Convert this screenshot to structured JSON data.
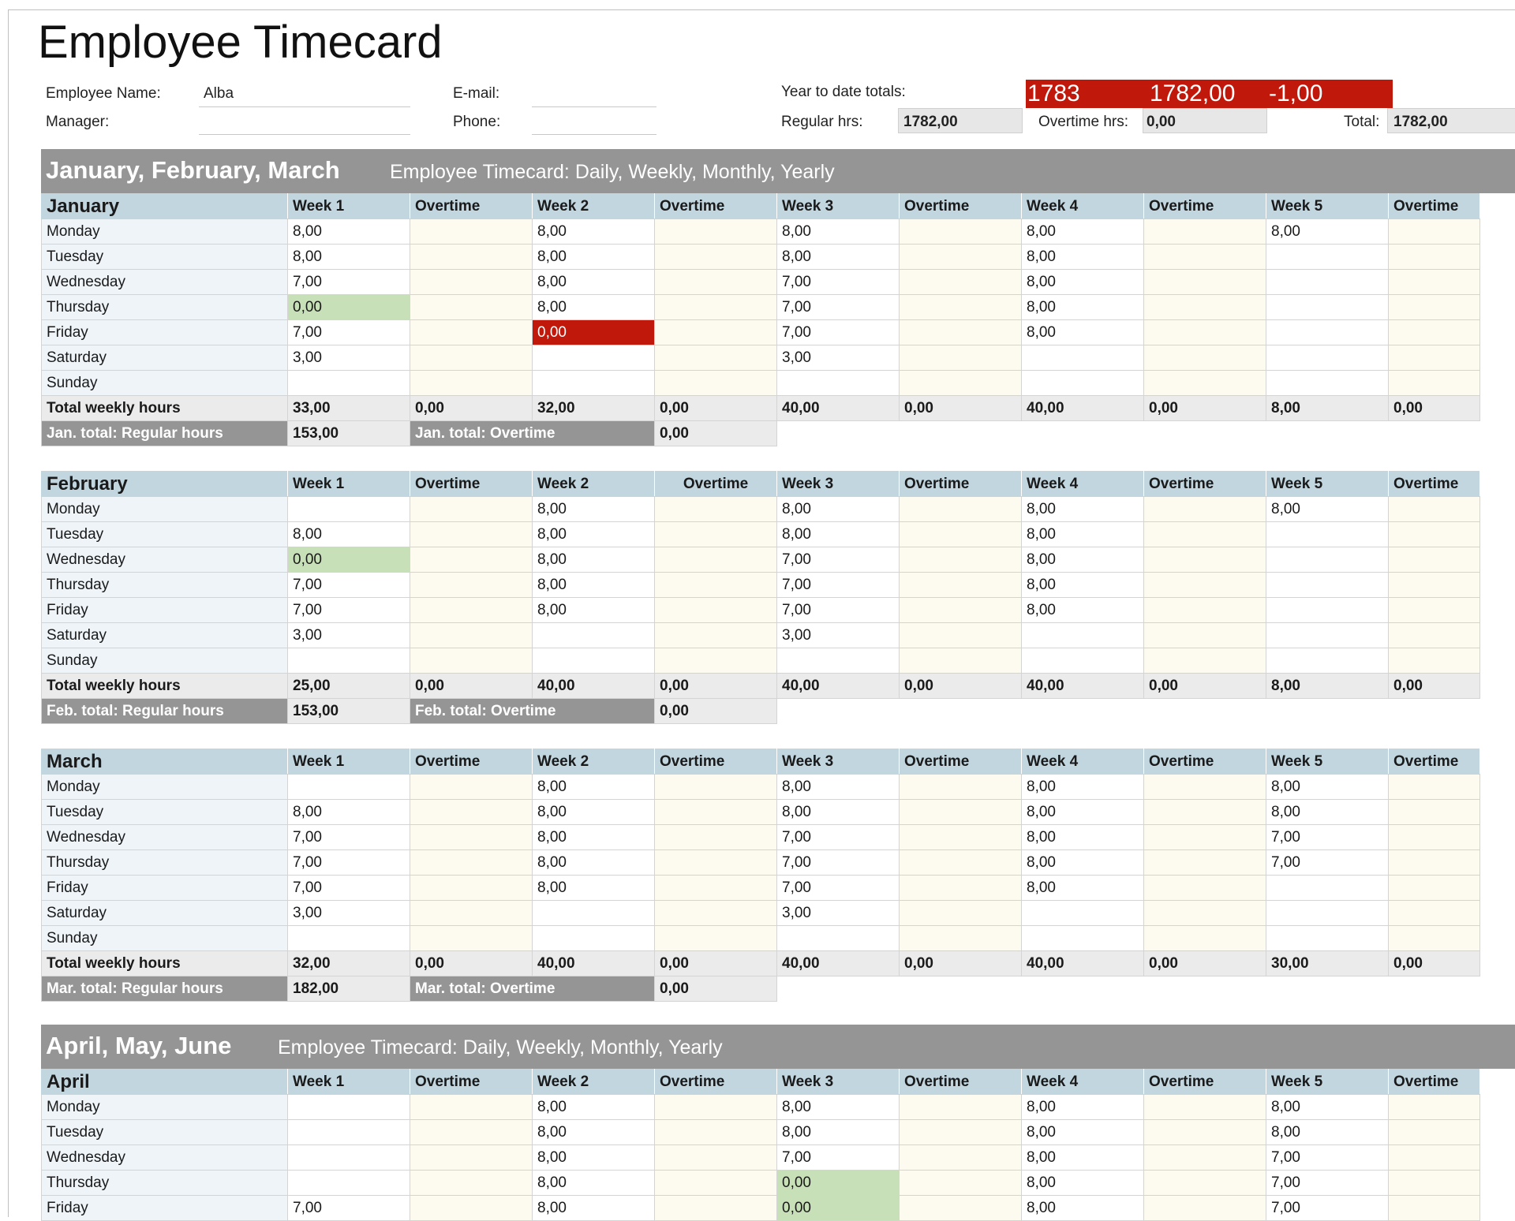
{
  "title": "Employee Timecard",
  "info": {
    "employee_name_label": "Employee Name:",
    "employee_name": "Alba",
    "manager_label": "Manager:",
    "manager": "",
    "email_label": "E-mail:",
    "email": "",
    "phone_label": "Phone:",
    "phone": ""
  },
  "ytd": {
    "label": "Year to date totals:",
    "v1": "1783",
    "v2": "1782,00",
    "v3": "-1,00",
    "regular_label": "Regular hrs:",
    "regular": "1782,00",
    "overtime_label": "Overtime hrs:",
    "overtime": "0,00",
    "total_label": "Total:",
    "total": "1782,00"
  },
  "colors": {
    "accent_red": "#c0180b",
    "header_blue": "#c2d6e0",
    "header_grey": "#959595",
    "green_highlight": "#c8e0b8"
  },
  "quarters": [
    {
      "title": "January, February, March",
      "subtitle": "Employee Timecard: Daily, Weekly, Monthly, Yearly"
    },
    {
      "title": "April, May, June",
      "subtitle": "Employee Timecard: Daily, Weekly, Monthly, Yearly"
    }
  ],
  "cols": [
    "Week 1",
    "Overtime",
    "Week 2",
    "Overtime",
    "Week 3",
    "Overtime",
    "Week 4",
    "Overtime",
    "Week 5",
    "Overtime"
  ],
  "months": [
    {
      "name": "January",
      "days": [
        "Monday",
        "Tuesday",
        "Wednesday",
        "Thursday",
        "Friday",
        "Saturday",
        "Sunday"
      ],
      "rows": [
        [
          "8,00",
          "",
          "8,00",
          "",
          "8,00",
          "",
          "8,00",
          "",
          "8,00",
          ""
        ],
        [
          "8,00",
          "",
          "8,00",
          "",
          "8,00",
          "",
          "8,00",
          "",
          "",
          ""
        ],
        [
          "7,00",
          "",
          "8,00",
          "",
          "7,00",
          "",
          "8,00",
          "",
          "",
          ""
        ],
        [
          "0,00",
          "",
          "8,00",
          "",
          "7,00",
          "",
          "8,00",
          "",
          "",
          ""
        ],
        [
          "7,00",
          "",
          "0,00",
          "",
          "7,00",
          "",
          "8,00",
          "",
          "",
          ""
        ],
        [
          "3,00",
          "",
          "",
          "",
          "3,00",
          "",
          "",
          "",
          "",
          ""
        ],
        [
          "",
          "",
          "",
          "",
          "",
          "",
          "",
          "",
          "",
          ""
        ]
      ],
      "total_label": "Total weekly hours",
      "totals": [
        "33,00",
        "0,00",
        "32,00",
        "0,00",
        "40,00",
        "0,00",
        "40,00",
        "0,00",
        "8,00",
        "0,00"
      ],
      "reg_label": "Jan. total: Regular hours",
      "reg_value": "153,00",
      "ot_label": "Jan. total: Overtime",
      "ot_value": "0,00"
    },
    {
      "name": "February",
      "days": [
        "Monday",
        "Tuesday",
        "Wednesday",
        "Thursday",
        "Friday",
        "Saturday",
        "Sunday"
      ],
      "rows": [
        [
          "",
          "",
          "8,00",
          "",
          "8,00",
          "",
          "8,00",
          "",
          "8,00",
          ""
        ],
        [
          "8,00",
          "",
          "8,00",
          "",
          "8,00",
          "",
          "8,00",
          "",
          "",
          ""
        ],
        [
          "0,00",
          "",
          "8,00",
          "",
          "7,00",
          "",
          "8,00",
          "",
          "",
          ""
        ],
        [
          "7,00",
          "",
          "8,00",
          "",
          "7,00",
          "",
          "8,00",
          "",
          "",
          ""
        ],
        [
          "7,00",
          "",
          "8,00",
          "",
          "7,00",
          "",
          "8,00",
          "",
          "",
          ""
        ],
        [
          "3,00",
          "",
          "",
          "",
          "3,00",
          "",
          "",
          "",
          "",
          ""
        ],
        [
          "",
          "",
          "",
          "",
          "",
          "",
          "",
          "",
          "",
          ""
        ]
      ],
      "total_label": "Total weekly hours",
      "totals": [
        "25,00",
        "0,00",
        "40,00",
        "0,00",
        "40,00",
        "0,00",
        "40,00",
        "0,00",
        "8,00",
        "0,00"
      ],
      "reg_label": "Feb. total: Regular hours",
      "reg_value": "153,00",
      "ot_label": "Feb.  total: Overtime",
      "ot_value": "0,00"
    },
    {
      "name": "March",
      "days": [
        "Monday",
        "Tuesday",
        "Wednesday",
        "Thursday",
        "Friday",
        "Saturday",
        "Sunday"
      ],
      "rows": [
        [
          "",
          "",
          "8,00",
          "",
          "8,00",
          "",
          "8,00",
          "",
          "8,00",
          ""
        ],
        [
          "8,00",
          "",
          "8,00",
          "",
          "8,00",
          "",
          "8,00",
          "",
          "8,00",
          ""
        ],
        [
          "7,00",
          "",
          "8,00",
          "",
          "7,00",
          "",
          "8,00",
          "",
          "7,00",
          ""
        ],
        [
          "7,00",
          "",
          "8,00",
          "",
          "7,00",
          "",
          "8,00",
          "",
          "7,00",
          ""
        ],
        [
          "7,00",
          "",
          "8,00",
          "",
          "7,00",
          "",
          "8,00",
          "",
          "",
          ""
        ],
        [
          "3,00",
          "",
          "",
          "",
          "3,00",
          "",
          "",
          "",
          "",
          ""
        ],
        [
          "",
          "",
          "",
          "",
          "",
          "",
          "",
          "",
          "",
          ""
        ]
      ],
      "total_label": "Total weekly hours",
      "totals": [
        "32,00",
        "0,00",
        "40,00",
        "0,00",
        "40,00",
        "0,00",
        "40,00",
        "0,00",
        "30,00",
        "0,00"
      ],
      "reg_label": "Mar. total: Regular hours",
      "reg_value": "182,00",
      "ot_label": "Mar. total: Overtime",
      "ot_value": "0,00"
    },
    {
      "name": "April",
      "days": [
        "Monday",
        "Tuesday",
        "Wednesday",
        "Thursday",
        "Friday"
      ],
      "rows": [
        [
          "",
          "",
          "8,00",
          "",
          "8,00",
          "",
          "8,00",
          "",
          "8,00",
          ""
        ],
        [
          "",
          "",
          "8,00",
          "",
          "8,00",
          "",
          "8,00",
          "",
          "8,00",
          ""
        ],
        [
          "",
          "",
          "8,00",
          "",
          "7,00",
          "",
          "8,00",
          "",
          "7,00",
          ""
        ],
        [
          "",
          "",
          "8,00",
          "",
          "0,00",
          "",
          "8,00",
          "",
          "7,00",
          ""
        ],
        [
          "7,00",
          "",
          "8,00",
          "",
          "0,00",
          "",
          "8,00",
          "",
          "7,00",
          ""
        ]
      ]
    }
  ]
}
